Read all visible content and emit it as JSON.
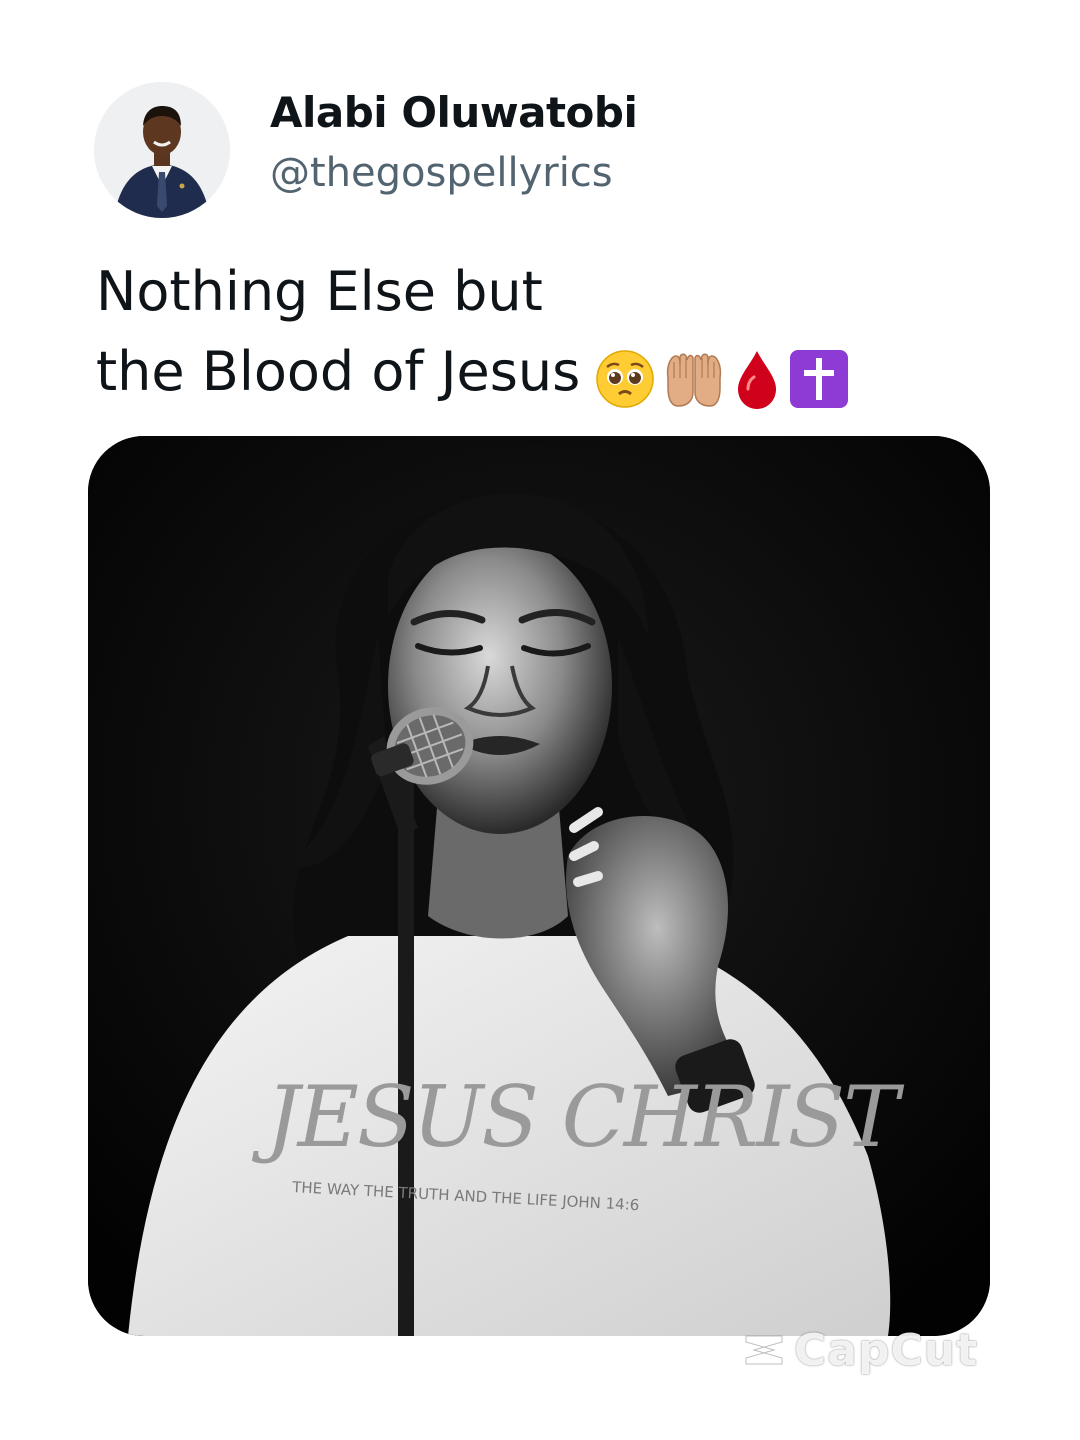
{
  "author": {
    "display_name": "Alabi Oluwatobi",
    "handle": "@thegospellyrics",
    "avatar_icon": "profile-photo"
  },
  "post": {
    "line1": "Nothing Else but",
    "line2": "the Blood of Jesus",
    "emojis": [
      "pleading-face-icon",
      "palms-up-together-icon",
      "drop-of-blood-icon",
      "latin-cross-icon"
    ]
  },
  "media": {
    "shirt_text_main": "JESUS CHRIST",
    "shirt_text_sub": "THE WAY THE TRUTH AND THE LIFE JOHN 14:6"
  },
  "watermark": {
    "label": "CapCut"
  },
  "colors": {
    "text_primary": "#0f1419",
    "text_secondary": "#536471",
    "blood_red": "#d0021b",
    "cross_purple": "#8e3bd6"
  }
}
